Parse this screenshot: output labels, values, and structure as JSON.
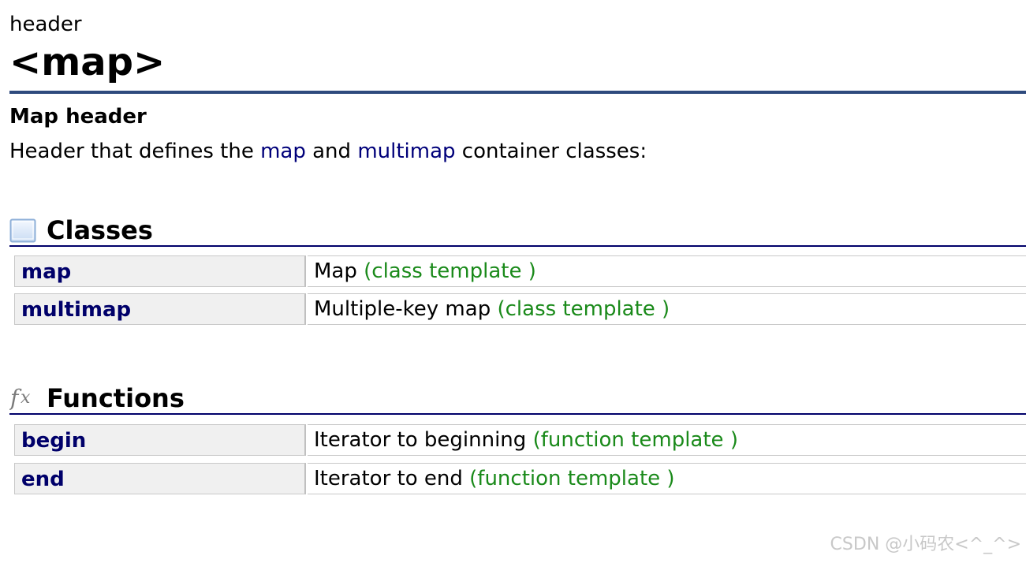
{
  "header": {
    "kicker": "header",
    "title": "<map>"
  },
  "intro": {
    "subtitle": "Map header",
    "desc_prefix": "Header that defines the ",
    "link_map": "map",
    "desc_middle": " and ",
    "link_multimap": "multimap",
    "desc_suffix": " container classes:"
  },
  "classes": {
    "icon": "class-box-icon",
    "title": "Classes",
    "rows": [
      {
        "name": "map",
        "desc": "Map ",
        "kind": "(class template )"
      },
      {
        "name": "multimap",
        "desc": "Multiple-key map ",
        "kind": "(class template )"
      }
    ]
  },
  "functions": {
    "icon": "fx-function-icon",
    "title": "Functions",
    "rows": [
      {
        "name": "begin",
        "desc": "Iterator to beginning ",
        "kind": "(function template )"
      },
      {
        "name": "end",
        "desc": "Iterator to end ",
        "kind": "(function template )"
      }
    ]
  },
  "watermark": "CSDN @小码农<^_^>",
  "colors": {
    "title_rule": "#2e4a7d",
    "section_rule": "#00006a",
    "link": "#00007a",
    "kind": "#1a8a1a",
    "key_bg": "#f0f0f0"
  }
}
